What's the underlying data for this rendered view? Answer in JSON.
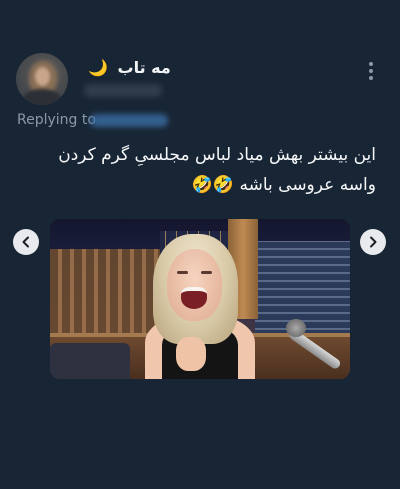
{
  "tweet": {
    "display_name": "مه تاب",
    "name_emoji": "🌙",
    "replying_label": "Replying to",
    "text_lines": [
      "این بیشتر بهش میاد لباس مجلسیِ گرم کردن",
      "واسه عروسی باشه 🤣🤣"
    ]
  },
  "media": {
    "prev_icon": "chevron-left-icon",
    "next_icon": "chevron-right-icon"
  },
  "colors": {
    "background": "#182534",
    "secondary_text": "#8b98a5",
    "link": "#3a6ea5"
  }
}
